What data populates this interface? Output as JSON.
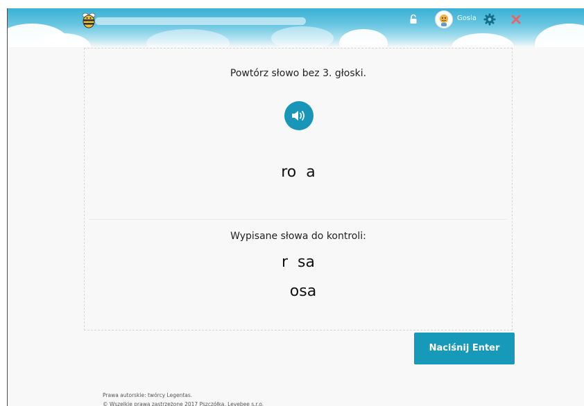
{
  "header": {
    "progress": 0,
    "username": "Gosia",
    "colors": {
      "sky": "#39b1d4",
      "settings": "#136f8a",
      "close": "#e8646a"
    }
  },
  "exercise": {
    "instruction": "Powtórz słowo bez 3. głoski.",
    "word": "ro  a",
    "check_label": "Wypisane słowa do kontroli:",
    "typed_words": [
      "r  sa",
      "  osa"
    ]
  },
  "actions": {
    "enter_label": "Naciśnij Enter"
  },
  "footer": {
    "line1": "Prawa autorskie: twórcy Legentas.",
    "line2": "© Wszelkie prawa zastrzeżone 2017 Pszczółka, Levebee s.r.o."
  }
}
